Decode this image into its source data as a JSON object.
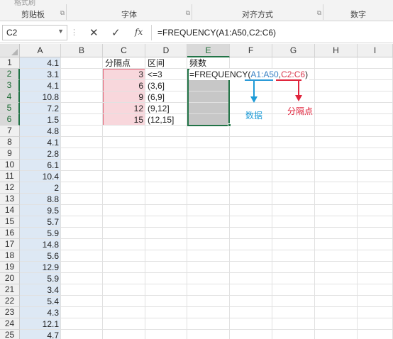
{
  "ribbon": {
    "top_cut_label": "格式刷",
    "groups": [
      "剪贴板",
      "字体",
      "对齐方式",
      "数字"
    ]
  },
  "formula_bar": {
    "name_box": "C2",
    "cancel": "✕",
    "enter": "✓",
    "fx": "fx",
    "formula": "=FREQUENCY(A1:A50,C2:C6)"
  },
  "columns": [
    "A",
    "B",
    "C",
    "D",
    "E",
    "F",
    "G",
    "H",
    "I"
  ],
  "rows": [
    "1",
    "2",
    "3",
    "4",
    "5",
    "6",
    "7",
    "8",
    "9",
    "10",
    "11",
    "12",
    "13",
    "14",
    "15",
    "16",
    "17",
    "18",
    "19",
    "20",
    "21",
    "22",
    "23",
    "24",
    "25"
  ],
  "colA": [
    "4.1",
    "3.1",
    "4.1",
    "10.8",
    "7.2",
    "1.5",
    "4.8",
    "4.1",
    "2.8",
    "6.1",
    "10.4",
    "2",
    "8.8",
    "9.5",
    "5.7",
    "5.9",
    "14.8",
    "5.6",
    "12.9",
    "5.9",
    "3.4",
    "5.4",
    "4.3",
    "12.1",
    "4.7"
  ],
  "headers": {
    "c1": "分隔点",
    "d1": "区间",
    "e1": "频数"
  },
  "breakpoints": [
    "3",
    "6",
    "9",
    "12",
    "15"
  ],
  "intervals": [
    "<=3",
    "(3,6]",
    "(6,9]",
    "(9,12]",
    "(12,15]"
  ],
  "formula_cell": {
    "prefix": "=FREQUENCY(",
    "ref1": "A1:A50",
    "sep": ",",
    "ref2": "C2:C6",
    "suffix": ")"
  },
  "annotations": {
    "data": "数据",
    "breakpoints": "分隔点"
  },
  "colors": {
    "accent_green": "#217346",
    "blue_annotation": "#1d9bd7",
    "red_annotation": "#e0243c",
    "range_pink": "#f8d7dc",
    "colA_fill": "#dde8f4"
  }
}
